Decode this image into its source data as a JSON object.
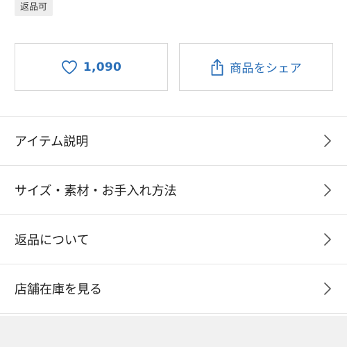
{
  "badge": {
    "label": "返品可"
  },
  "actions": {
    "like_count": "1,090",
    "share_label": "商品をシェア"
  },
  "menu": {
    "items": [
      {
        "label": "アイテム説明"
      },
      {
        "label": "サイズ・素材・お手入れ方法"
      },
      {
        "label": "返品について"
      },
      {
        "label": "店舗在庫を見る"
      }
    ]
  },
  "colors": {
    "accent": "#2a6fb8",
    "border": "#d6d6d6",
    "badge_bg": "#eeeeee",
    "footer_bg": "#f1f1f1"
  },
  "icons": {
    "like": "heart-icon",
    "share": "share-icon",
    "chevron": "chevron-right-icon"
  }
}
